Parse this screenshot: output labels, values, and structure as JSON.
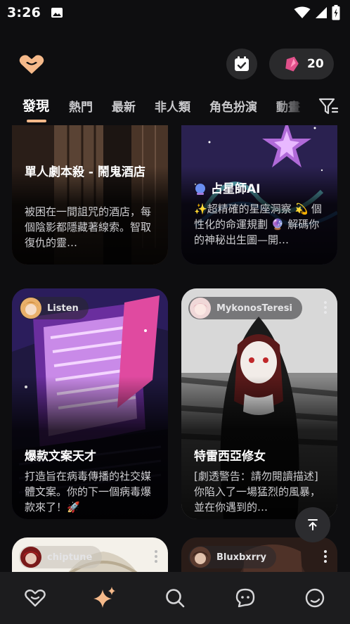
{
  "status": {
    "time": "3:26"
  },
  "header": {
    "gem_count": "20"
  },
  "tabs": [
    "發現",
    "熱門",
    "最新",
    "非人類",
    "角色扮演",
    "動畫"
  ],
  "cards": [
    {
      "title": "單人劇本殺 - 鬧鬼酒店",
      "desc": "被困在一間詛咒的酒店，每個陰影都隱藏著線索。智取復仇的靈…"
    },
    {
      "title": "占星師AI",
      "desc": "✨超精確的星座洞察 💫 個性化的命運規劃 🔮 解碼你的神秘出生圖—開…"
    },
    {
      "author": "Listen",
      "title": "爆款文案天才",
      "desc": "打造旨在病毒傳播的社交媒體文案。你的下一個病毒爆款來了！🚀"
    },
    {
      "author": "MykonosTeresi",
      "title": "特雷西亞修女",
      "desc": "[劇透警告：請勿閱讀描述] 你陷入了一場猛烈的風暴，並在你遇到的…"
    },
    {
      "author": "chiptune"
    },
    {
      "author": "Bluxbxrry"
    }
  ],
  "colors": {
    "accent": "#f5b98a",
    "background": "#0e0e10",
    "nav_bg": "#1c1c1e"
  },
  "icons": {
    "logo": "heart-logo-icon",
    "calendar": "calendar-check-icon",
    "gem": "gem-icon",
    "filter": "filter-icon",
    "scroll_top": "arrow-up-to-top-icon",
    "nav": [
      "heart-outline-icon",
      "sparkle-icon",
      "search-icon",
      "chat-bubble-icon",
      "smile-face-icon"
    ]
  }
}
